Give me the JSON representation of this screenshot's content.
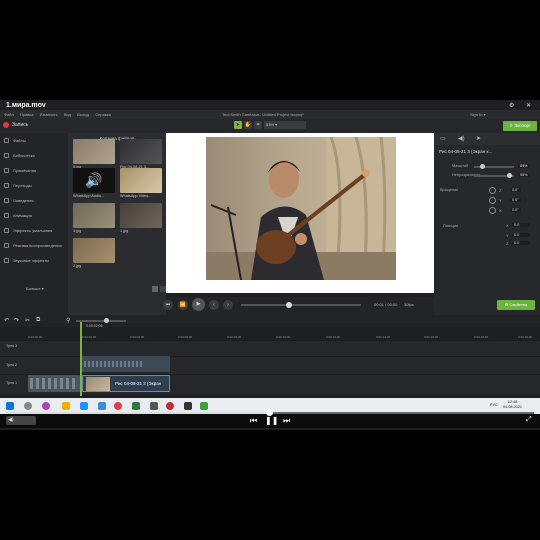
{
  "video": {
    "title": "1.мира.mov"
  },
  "app": {
    "menu": [
      "Файл",
      "Правка",
      "Изменить",
      "Вид",
      "Выход",
      "Справка"
    ],
    "window_title": "TechSmith Camtasia - Untitled Project.tscproj*",
    "signin": "Sign In ▾",
    "zoom": "53%",
    "export_label": "⇪ Экспорт"
  },
  "toolbar": {
    "record_label": "Запись"
  },
  "sidebar": {
    "items": [
      "Файлы",
      "Библиотека",
      "Примечания",
      "Переходы",
      "Поведения",
      "Анимация",
      "Эффекты умолчания",
      "Режимы воспроизведения",
      "Звуковые эффекты"
    ],
    "more_label": "Больше ▾"
  },
  "bin": {
    "title": "Корзина файлов",
    "items": [
      {
        "label": "5.jpg",
        "color": "#8a7a6a"
      },
      {
        "label": "Рис 04-08-21 3...",
        "color": "#2e2e34"
      },
      {
        "label": "WhatsApp Audio...",
        "color": "#1a1a1a"
      },
      {
        "label": "WhatsApp Video...",
        "color": "#a8926a"
      },
      {
        "label": "3.jpg",
        "color": "#6d6858"
      },
      {
        "label": "1.jpg",
        "color": "#45403a"
      },
      {
        "label": "2.jpg",
        "color": "#7a6a50"
      }
    ]
  },
  "player": {
    "timecode": "00:01 / 00:00",
    "fps": "30fps"
  },
  "properties": {
    "clip_name": "Рис 04-08-21 3 (Экран к...",
    "scale_label": "Масштаб",
    "scale_value": "89%",
    "opacity_label": "Непрозрачность",
    "opacity_value": "95%",
    "rotation_label": "Вращение",
    "rotation": [
      {
        "axis": "Z",
        "value": "0.0°"
      },
      {
        "axis": "Y",
        "value": "0.0°"
      },
      {
        "axis": "X",
        "value": "0.0°"
      }
    ],
    "position_label": "Позиция",
    "position": [
      {
        "axis": "X",
        "value": "0.0"
      },
      {
        "axis": "Y",
        "value": "0.0"
      },
      {
        "axis": "Z",
        "value": "0.0"
      }
    ],
    "properties_button": "⚙ Свойства"
  },
  "timeline": {
    "playhead_time": "0:00:02;06",
    "ticks": [
      "0:00:00;00",
      "0:00:02;00",
      "0:00:04;00",
      "0:00:06;00",
      "0:00:08;00",
      "0:00:10;00",
      "0:00:12;00",
      "0:00:14;00",
      "0:00:16;00",
      "0:00:18;00",
      "0:00:20;00"
    ],
    "tracks": [
      "Трек 3",
      "Трек 2",
      "Трек 1"
    ],
    "clip_label": "Рис 04-08-21 3 (Экран"
  },
  "taskbar": {
    "lang": "РУС",
    "time": "12:48",
    "date": "04.08.2021"
  },
  "media_player": {
    "volume_label": "◀)"
  }
}
